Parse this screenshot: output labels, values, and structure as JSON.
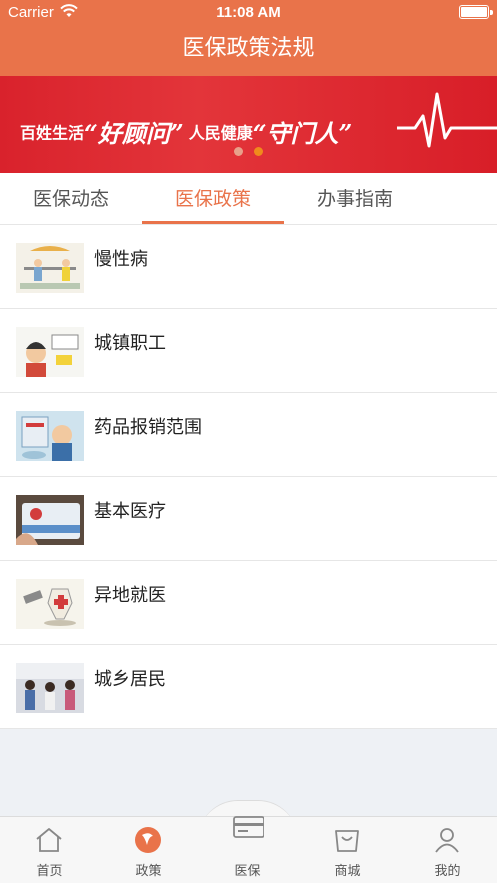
{
  "status_bar": {
    "carrier": "Carrier",
    "time": "11:08 AM"
  },
  "header": {
    "title": "医保政策法规"
  },
  "banner": {
    "text_1": "百姓生活",
    "quote_1": "“好顾问”",
    "text_2": "人民健康",
    "quote_2": "“守门人”",
    "active_dot_index": 1
  },
  "tabs": [
    {
      "label": "医保动态",
      "active": false
    },
    {
      "label": "医保政策",
      "active": true
    },
    {
      "label": "办事指南",
      "active": false
    }
  ],
  "list": [
    {
      "label": "慢性病"
    },
    {
      "label": "城镇职工"
    },
    {
      "label": "药品报销范围"
    },
    {
      "label": "基本医疗"
    },
    {
      "label": "异地就医"
    },
    {
      "label": "城乡居民"
    }
  ],
  "tabbar": [
    {
      "label": "首页",
      "icon": "home-icon"
    },
    {
      "label": "政策",
      "icon": "policy-icon"
    },
    {
      "label": "医保",
      "icon": "card-icon"
    },
    {
      "label": "商城",
      "icon": "shop-bag-icon"
    },
    {
      "label": "我的",
      "icon": "user-icon"
    }
  ],
  "colors": {
    "accent": "#e9734a",
    "banner_red": "#d9222c"
  }
}
